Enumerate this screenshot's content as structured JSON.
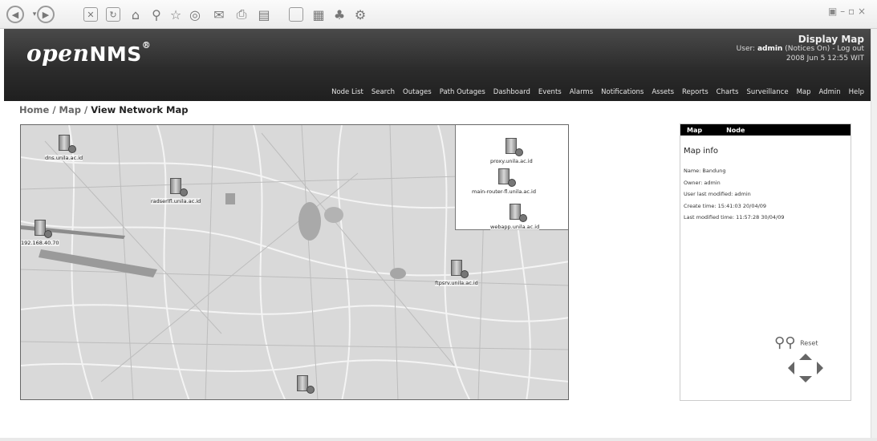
{
  "browser": {
    "toolbar_icons": [
      "back-icon",
      "forward-icon",
      "stop-icon",
      "refresh-icon",
      "home-icon",
      "search-icon",
      "favorites-icon",
      "history-icon",
      "mail-icon",
      "print-icon",
      "edit-icon",
      "discuss-icon",
      "messenger-icon",
      "research-icon",
      "tools-icon"
    ]
  },
  "header": {
    "logo_word": "open",
    "logo_bold": "NMS",
    "logo_mark": "®",
    "page_title": "Display Map",
    "user_prefix": "User:",
    "user_name": "admin",
    "notices": "(Notices On)",
    "logout": "Log out",
    "datetime": "2008 Jun 5   12:55 WIT"
  },
  "nav": [
    "Node List",
    "Search",
    "Outages",
    "Path Outages",
    "Dashboard",
    "Events",
    "Alarms",
    "Notifications",
    "Assets",
    "Reports",
    "Charts",
    "Surveillance",
    "Map",
    "Admin",
    "Help"
  ],
  "breadcrumb": {
    "home": "Home",
    "sep": "/",
    "map": "Map",
    "current": "View Network Map"
  },
  "map": {
    "nodes": [
      {
        "label": "dns.unila.ac.id"
      },
      {
        "label": "radserlfl.unila.ac.id"
      },
      {
        "label": "192.168.40.70"
      },
      {
        "label": "ftpsrv.unila.ac.id"
      },
      {
        "label": ""
      },
      {
        "label": "proxy.unila.ac.id"
      },
      {
        "label": "main-router-fl.unila.ac.id"
      },
      {
        "label": "webapp.unila.ac.id"
      }
    ]
  },
  "panel": {
    "tab_map": "Map",
    "tab_node": "Node",
    "title": "Map info",
    "name": "Name: Bandung",
    "owner": "Owner: admin",
    "modified_by": "User last modified: admin",
    "create_time": "Create time: 15:41:03 20/04/09",
    "modified_time": "Last modified time: 11:57:28 30/04/09",
    "reset": "Reset"
  }
}
